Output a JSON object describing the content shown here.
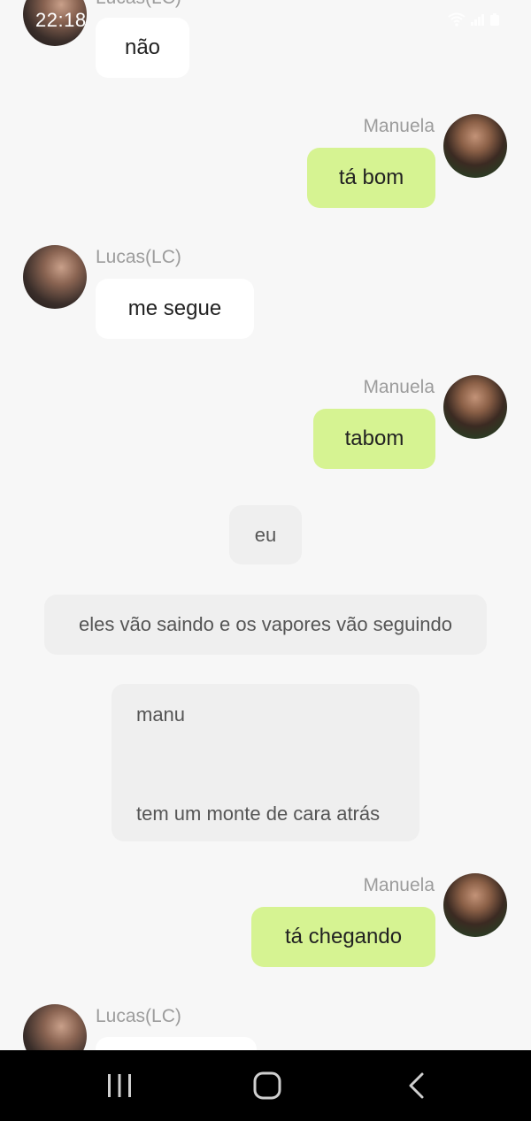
{
  "status_bar": {
    "time": "22:18",
    "icons": [
      "wifi-icon",
      "signal-icon",
      "battery-icon"
    ]
  },
  "participants": {
    "lucas": "Lucas(LC)",
    "manuela": "Manuela"
  },
  "messages": [
    {
      "sender": "Lucas(LC)",
      "direction": "incoming",
      "text": "não"
    },
    {
      "sender": "Manuela",
      "direction": "outgoing",
      "text": "tá bom"
    },
    {
      "sender": "Lucas(LC)",
      "direction": "incoming",
      "text": "me segue"
    },
    {
      "sender": "Manuela",
      "direction": "outgoing",
      "text": "tabom"
    },
    {
      "sender": "",
      "direction": "center",
      "text": "eu"
    },
    {
      "sender": "",
      "direction": "center",
      "text": "eles vão saindo e os vapores vão seguindo"
    },
    {
      "sender": "",
      "direction": "center",
      "lines": [
        "manu",
        "tem um monte de cara atrás"
      ]
    },
    {
      "sender": "Manuela",
      "direction": "outgoing",
      "text": "tá chegando"
    },
    {
      "sender": "Lucas(LC)",
      "direction": "incoming",
      "text": ""
    }
  ],
  "colors": {
    "background": "#f7f7f7",
    "incoming_bubble": "#ffffff",
    "outgoing_bubble": "#d6f392",
    "system_bubble": "#efefef",
    "name_text": "#9c9c9c",
    "nav_bar": "#000000"
  },
  "navigation": {
    "buttons": [
      "recent-apps-icon",
      "home-icon",
      "back-icon"
    ]
  }
}
